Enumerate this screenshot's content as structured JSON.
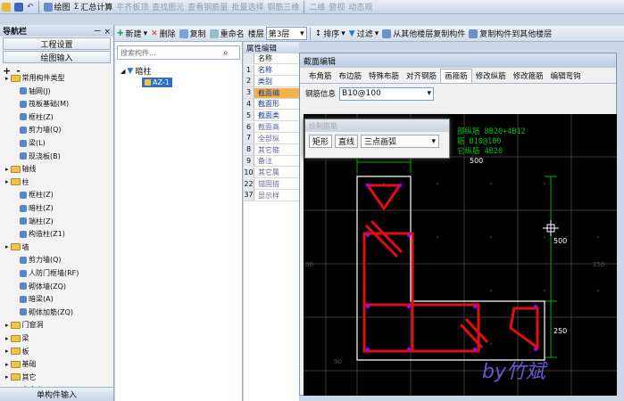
{
  "toolbar1": {
    "items": [
      "绘图",
      "汇总计算",
      "平齐板顶",
      "查找图元",
      "查看钢筋量",
      "批量选择",
      "钢筋三维"
    ],
    "right": [
      "二维",
      "俯视",
      "动态观"
    ]
  },
  "toolbar2": {
    "new": "新建",
    "delete": "删除",
    "copy": "复制",
    "rename": "重命名",
    "floor_label": "楼层",
    "floor_value": "第3层",
    "sort": "排序",
    "filter": "过滤",
    "copy_from_floor": "从其他楼层复制构件",
    "copy_to_floor": "复制构件到其他楼层"
  },
  "nav": {
    "title": "导航栏",
    "pin": "ㄧ",
    "close": "×",
    "btn_settings": "工程设置",
    "btn_draw": "绘图输入",
    "expand": "+",
    "collapse": "-"
  },
  "tree": [
    {
      "label": "常用构件类型",
      "depth": 0,
      "type": "folder"
    },
    {
      "label": "轴网(J)",
      "depth": 1,
      "type": "item"
    },
    {
      "label": "筏板基础(M)",
      "depth": 1,
      "type": "item"
    },
    {
      "label": "框柱(Z)",
      "depth": 1,
      "type": "item"
    },
    {
      "label": "剪力墙(Q)",
      "depth": 1,
      "type": "item"
    },
    {
      "label": "梁(L)",
      "depth": 1,
      "type": "item"
    },
    {
      "label": "现浇板(B)",
      "depth": 1,
      "type": "item"
    },
    {
      "label": "轴线",
      "depth": 0,
      "type": "folder"
    },
    {
      "label": "柱",
      "depth": 0,
      "type": "folder"
    },
    {
      "label": "框柱(Z)",
      "depth": 1,
      "type": "item"
    },
    {
      "label": "暗柱(Z)",
      "depth": 1,
      "type": "item"
    },
    {
      "label": "端柱(Z)",
      "depth": 1,
      "type": "item"
    },
    {
      "label": "构造柱(Z1)",
      "depth": 1,
      "type": "item"
    },
    {
      "label": "墙",
      "depth": 0,
      "type": "folder"
    },
    {
      "label": "剪力墙(Q)",
      "depth": 1,
      "type": "item"
    },
    {
      "label": "人防门框墙(RF)",
      "depth": 1,
      "type": "item"
    },
    {
      "label": "砌体墙(ZQ)",
      "depth": 1,
      "type": "item"
    },
    {
      "label": "暗梁(A)",
      "depth": 1,
      "type": "item"
    },
    {
      "label": "砌体加筋(ZQ)",
      "depth": 1,
      "type": "item"
    },
    {
      "label": "门窗洞",
      "depth": 0,
      "type": "folder"
    },
    {
      "label": "梁",
      "depth": 0,
      "type": "folder"
    },
    {
      "label": "板",
      "depth": 0,
      "type": "folder"
    },
    {
      "label": "基础",
      "depth": 0,
      "type": "folder"
    },
    {
      "label": "其它",
      "depth": 0,
      "type": "folder"
    },
    {
      "label": "自定义",
      "depth": 0,
      "type": "folder"
    }
  ],
  "nav_bottom": "单构件输入",
  "search": {
    "placeholder": "搜索构件..."
  },
  "comp_tree": {
    "root": "暗柱",
    "child": "AZ-1"
  },
  "prop": {
    "tab": "属性编辑",
    "header": "名称",
    "rows": [
      {
        "n": "1",
        "v": "名称"
      },
      {
        "n": "2",
        "v": "类别"
      },
      {
        "n": "3",
        "v": "截面编"
      },
      {
        "n": "4",
        "v": "截面形"
      },
      {
        "n": "5",
        "v": "截面类"
      },
      {
        "n": "6",
        "v": "截面高"
      },
      {
        "n": "7",
        "v": "全部纵"
      },
      {
        "n": "8",
        "v": "其它箍"
      },
      {
        "n": "9",
        "v": "备注"
      },
      {
        "n": "10",
        "v": "其它属"
      },
      {
        "n": "22",
        "v": "锚固搭"
      },
      {
        "n": "37",
        "v": "显示样"
      }
    ]
  },
  "dialog": {
    "title": "截面编辑",
    "tabs": [
      "布角筋",
      "布边筋",
      "特殊布筋",
      "对齐钢筋",
      "画箍筋",
      "修改纵筋",
      "修改箍筋",
      "编辑弯钩"
    ],
    "active_tab": "画箍筋",
    "rebar_info_label": "钢筋信息",
    "rebar_info_value": "B10@100"
  },
  "popup": {
    "title": "绘制箍筋",
    "rect": "矩形",
    "line": "直线",
    "arc": "三点画弧"
  },
  "canvas_text": {
    "line1": "部纵筋 8B20+4B12",
    "line2": "筋 B10@100",
    "line3": "它纵筋 4B20",
    "dim_top": "500",
    "dim_right1": "500",
    "dim_right2": "250",
    "grid1": "00",
    "grid2": "250",
    "grid3": "00",
    "watermark": "by竹斌"
  },
  "colors": {
    "canvas_bg": "#000000",
    "rebar": "#e01010",
    "outline": "#ffffff",
    "dim": "#00c000",
    "text_green": "#00c000",
    "watermark": "#6a57d6"
  }
}
